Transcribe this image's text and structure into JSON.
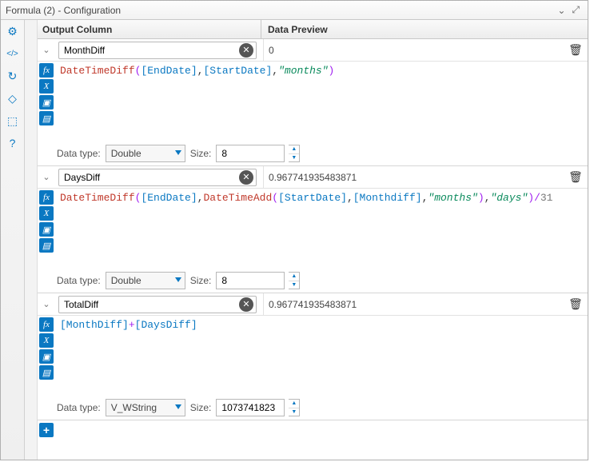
{
  "title": "Formula (2) - Configuration",
  "headers": {
    "output": "Output Column",
    "preview": "Data Preview"
  },
  "labels": {
    "datatype": "Data type:",
    "size": "Size:"
  },
  "icons": {
    "fx": "fx",
    "x": "X",
    "folder": "📁",
    "save": "💾",
    "gear": "⚙",
    "code": "</>",
    "refresh": "↻",
    "tag": "🔖",
    "box": "◫",
    "help": "?"
  },
  "blocks": [
    {
      "output": "MonthDiff",
      "preview": "0",
      "datatype": "Double",
      "size": "8",
      "formula": {
        "type": "f1"
      }
    },
    {
      "output": "DaysDiff",
      "preview": "0.967741935483871",
      "datatype": "Double",
      "size": "8",
      "formula": {
        "type": "f2"
      }
    },
    {
      "output": "TotalDiff",
      "preview": "0.967741935483871",
      "datatype": "V_WString",
      "size": "1073741823",
      "formula": {
        "type": "f3"
      }
    }
  ]
}
